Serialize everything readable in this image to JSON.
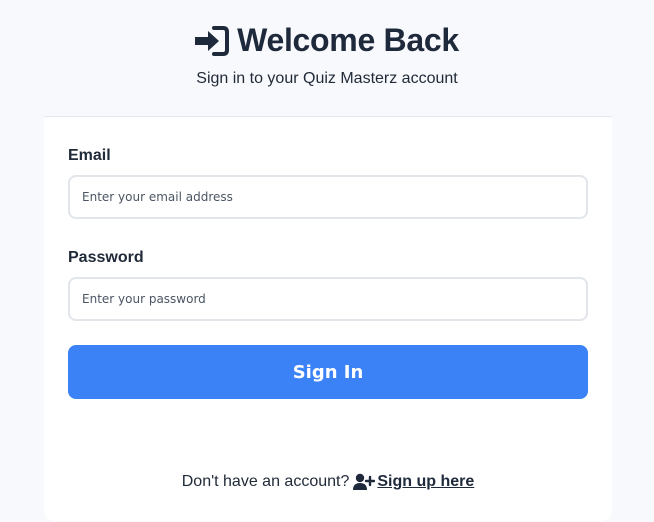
{
  "header": {
    "title": "Welcome Back",
    "title_icon": "sign-in-icon",
    "subtitle": "Sign in to your Quiz Masterz account"
  },
  "form": {
    "email_label": "Email",
    "email_placeholder": "Enter your email address",
    "email_value": "",
    "password_label": "Password",
    "password_placeholder": "Enter your password",
    "password_value": "",
    "submit_label": "Sign In"
  },
  "footer": {
    "prompt": "Don't have an account?",
    "signup_icon": "user-plus-icon",
    "signup_label": "Sign up here"
  },
  "colors": {
    "accent": "#3b82f6",
    "page_background": "#f8f9fc",
    "card_background": "#ffffff",
    "text": "#1e293b"
  }
}
